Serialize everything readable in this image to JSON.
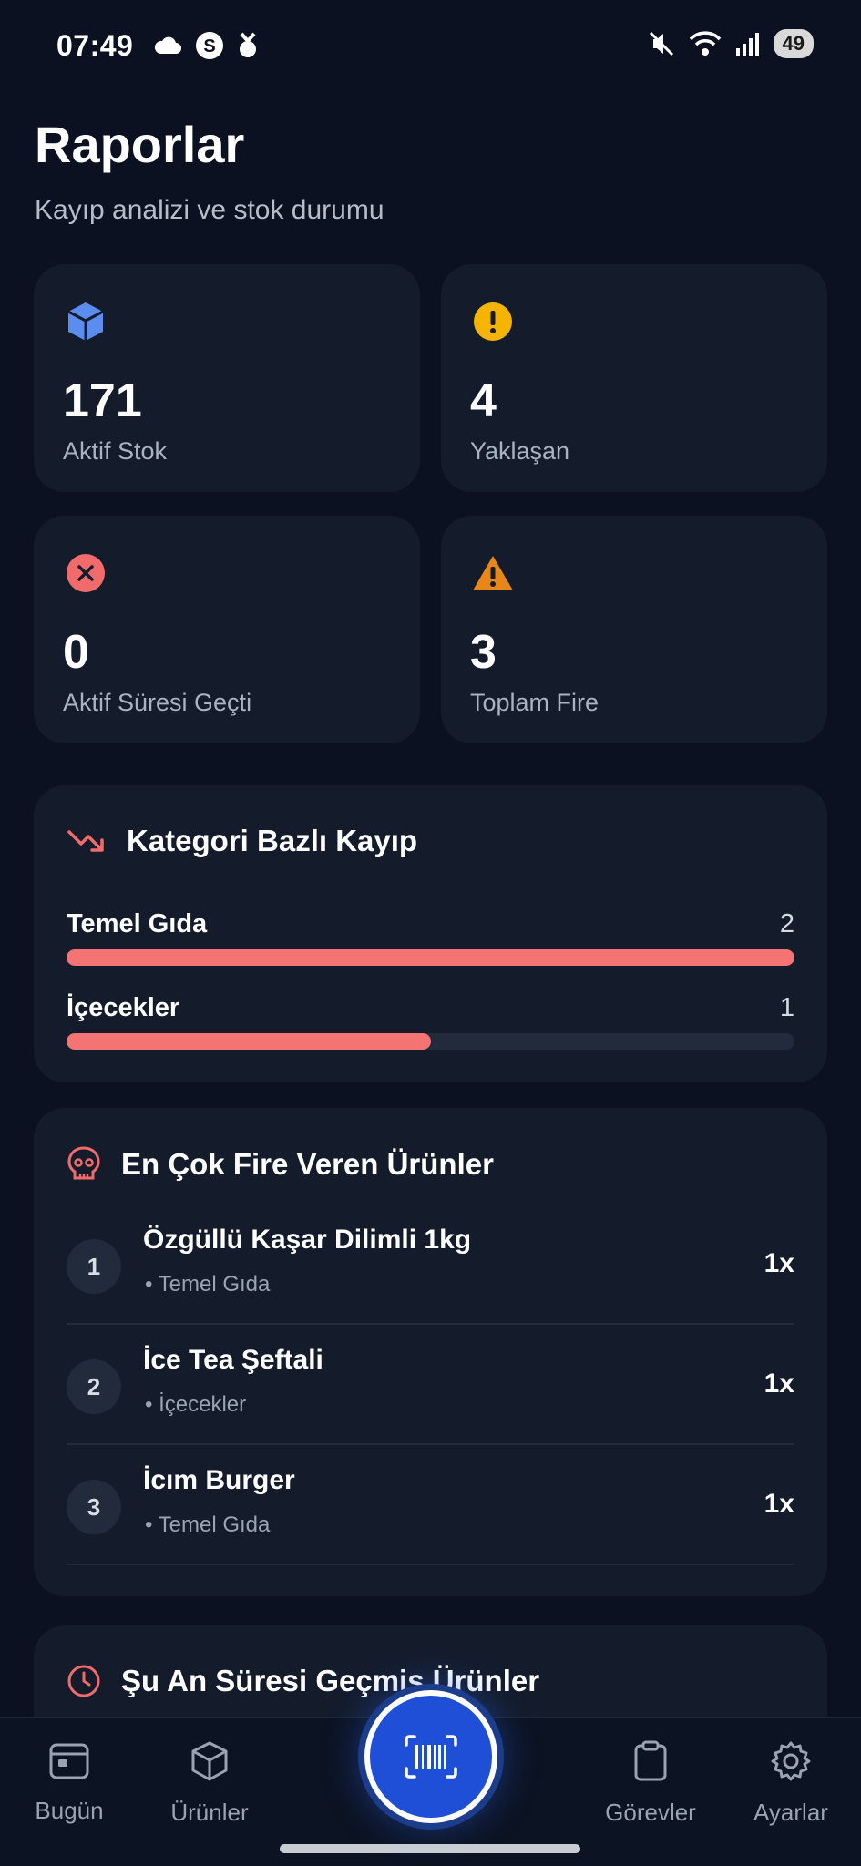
{
  "status": {
    "time": "07:49",
    "battery": "49"
  },
  "header": {
    "title": "Raporlar",
    "subtitle": "Kayıp analizi ve stok durumu"
  },
  "stats": [
    {
      "value": "171",
      "label": "Aktif Stok",
      "icon": "cube-icon",
      "color": "#5b8def"
    },
    {
      "value": "4",
      "label": "Yaklaşan",
      "icon": "exclamation-icon",
      "color": "#f4b400"
    },
    {
      "value": "0",
      "label": "Aktif Süresi Geçti",
      "icon": "x-circle-icon",
      "color": "#f16b6b"
    },
    {
      "value": "3",
      "label": "Toplam Fire",
      "icon": "warning-icon",
      "color": "#e8861a"
    }
  ],
  "category_loss": {
    "title": "Kategori Bazlı Kayıp",
    "items": [
      {
        "name": "Temel Gıda",
        "count": "2",
        "fraction": 1.0
      },
      {
        "name": "İçecekler",
        "count": "1",
        "fraction": 0.5
      }
    ]
  },
  "top_waste": {
    "title": "En Çok Fire Veren Ürünler",
    "items": [
      {
        "rank": "1",
        "name": "Özgüllü Kaşar Dilimli 1kg",
        "category": "Temel Gıda",
        "qty": "1x"
      },
      {
        "rank": "2",
        "name": "İce Tea Şeftali",
        "category": "İçecekler",
        "qty": "1x"
      },
      {
        "rank": "3",
        "name": "İcım Burger",
        "category": "Temel Gıda",
        "qty": "1x"
      }
    ]
  },
  "expired_now": {
    "title": "Şu An Süresi Geçmiş Ürünler"
  },
  "nav": {
    "today": "Bugün",
    "products": "Ürünler",
    "tasks": "Görevler",
    "settings": "Ayarlar"
  },
  "colors": {
    "background": "#0b1120",
    "card": "#141c2c",
    "accent": "#1f4fd6",
    "loss_bar": "#f47373"
  }
}
